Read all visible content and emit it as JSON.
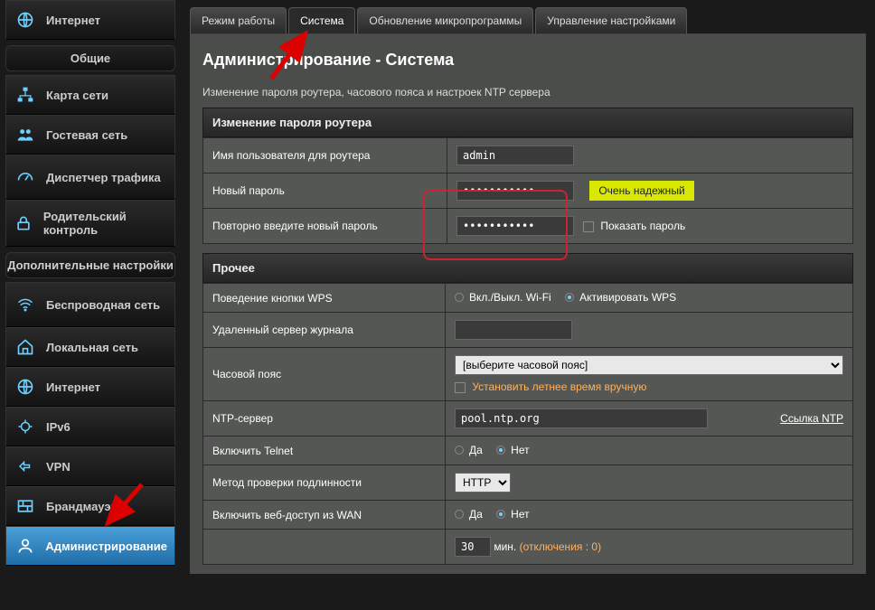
{
  "sidebar": {
    "internet_top": "Интернет",
    "group_general": "Общие",
    "items_general": [
      {
        "label": "Карта сети"
      },
      {
        "label": "Гостевая сеть"
      },
      {
        "label": "Диспетчер трафика"
      },
      {
        "label": "Родительский контроль"
      }
    ],
    "group_adv": "Дополнительные настройки",
    "items_adv": [
      {
        "label": "Беспроводная сеть"
      },
      {
        "label": "Локальная сеть"
      },
      {
        "label": "Интернет"
      },
      {
        "label": "IPv6"
      },
      {
        "label": "VPN"
      },
      {
        "label": "Брандмауэр"
      },
      {
        "label": "Администрирование"
      }
    ]
  },
  "tabs": [
    "Режим работы",
    "Система",
    "Обновление микропрограммы",
    "Управление настройками"
  ],
  "page": {
    "title": "Администрирование - Система",
    "desc": "Изменение пароля роутера, часового пояса и настроек NTP сервера",
    "section1": "Изменение пароля роутера",
    "username_label": "Имя пользователя для роутера",
    "username_value": "admin",
    "newpass_label": "Новый пароль",
    "newpass_value": "•••••••••••",
    "strength": "Очень надежный",
    "retype_label": "Повторно введите новый пароль",
    "retype_value": "•••••••••••",
    "showpass": "Показать пароль",
    "section2": "Прочее",
    "wps_label": "Поведение кнопки WPS",
    "wps_opt1": "Вкл./Выкл. Wi-Fi",
    "wps_opt2": "Активировать WPS",
    "remotelog_label": "Удаленный сервер журнала",
    "tz_label": "Часовой пояс",
    "tz_select": "[выберите часовой пояс]",
    "tz_dst": "Установить летнее время вручную",
    "ntp_label": "NTP-сервер",
    "ntp_value": "pool.ntp.org",
    "ntp_link": "Ссылка NTP",
    "telnet_label": "Включить Telnet",
    "yes": "Да",
    "no": "Нет",
    "auth_label": "Метод проверки подлинности",
    "auth_value": "HTTP",
    "wan_label": "Включить веб-доступ из WAN",
    "timeout_value": "30",
    "timeout_unit": "мин.",
    "timeout_info": "(отключения : 0)"
  }
}
